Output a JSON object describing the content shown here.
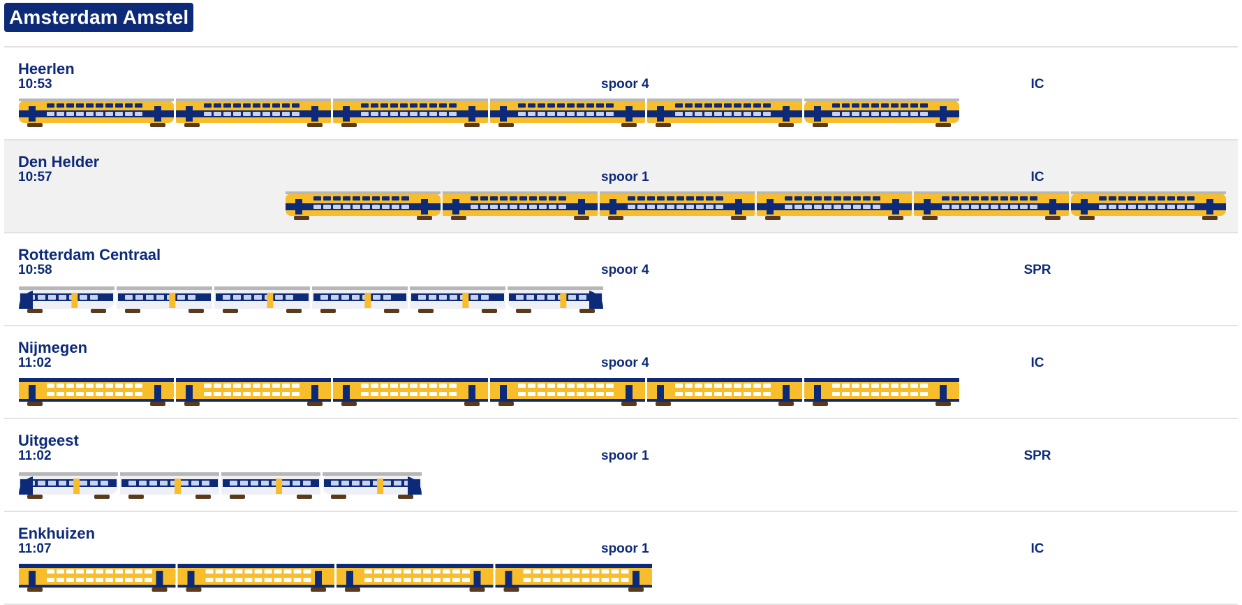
{
  "station": {
    "name": "Amsterdam Amstel"
  },
  "colors": {
    "ns_yellow": "#f7bd2a",
    "ns_blue": "#0d2a78",
    "sprinter_white": "#eef0f5",
    "roof_grey": "#b7b7b7",
    "row_alt_background": "#f1f1f1"
  },
  "departures": [
    {
      "destination": "Heerlen",
      "time": "10:53",
      "platform": "spoor 4",
      "train_type": "IC",
      "train_style": "double-deck-blue-stripe",
      "carriages": 6
    },
    {
      "destination": "Den Helder",
      "time": "10:57",
      "platform": "spoor 1",
      "train_type": "IC",
      "train_style": "double-deck-blue-stripe",
      "carriages": 6
    },
    {
      "destination": "Rotterdam Centraal",
      "time": "10:58",
      "platform": "spoor 4",
      "train_type": "SPR",
      "train_style": "sprinter",
      "carriages": 6
    },
    {
      "destination": "Nijmegen",
      "time": "11:02",
      "platform": "spoor 4",
      "train_type": "IC",
      "train_style": "double-deck-blue-roof",
      "carriages": 6
    },
    {
      "destination": "Uitgeest",
      "time": "11:02",
      "platform": "spoor 1",
      "train_type": "SPR",
      "train_style": "sprinter",
      "carriages": 4
    },
    {
      "destination": "Enkhuizen",
      "time": "11:07",
      "platform": "spoor 1",
      "train_type": "IC",
      "train_style": "double-deck-blue-roof",
      "carriages": 4
    }
  ]
}
